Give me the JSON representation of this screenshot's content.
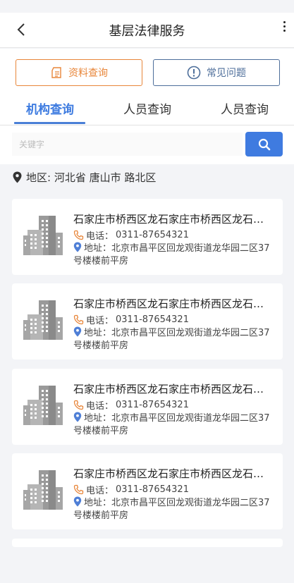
{
  "header": {
    "title": "基层法律服务"
  },
  "buttons": {
    "materials": "资料查询",
    "faq": "常见问题"
  },
  "tabs": [
    {
      "label": "机构查询"
    },
    {
      "label": "人员查询"
    },
    {
      "label": "人员查询"
    }
  ],
  "search": {
    "placeholder": "关键字"
  },
  "region": {
    "text": "地区: 河北省 唐山市 路北区"
  },
  "cards": [
    {
      "name": "石家庄市桥西区龙石家庄市桥西区龙石家庄市桥西区",
      "phone_label": "电话：",
      "phone": "0311-87654321",
      "addr_label": "地址：",
      "addr": "北京市昌平区回龙观街道龙华园二区37号楼楼前平房"
    },
    {
      "name": "石家庄市桥西区龙石家庄市桥西区龙石家庄市桥西区",
      "phone_label": "电话：",
      "phone": "0311-87654321",
      "addr_label": "地址：",
      "addr": "北京市昌平区回龙观街道龙华园二区37号楼楼前平房"
    },
    {
      "name": "石家庄市桥西区龙石家庄市桥西区龙石家庄市桥西区",
      "phone_label": "电话：",
      "phone": "0311-87654321",
      "addr_label": "地址：",
      "addr": "北京市昌平区回龙观街道龙华园二区37号楼楼前平房"
    },
    {
      "name": "石家庄市桥西区龙石家庄市桥西区龙石家庄市桥西区",
      "phone_label": "电话：",
      "phone": "0311-87654321",
      "addr_label": "地址：",
      "addr": "北京市昌平区回龙观街道龙华园二区37号楼楼前平房"
    }
  ],
  "colors": {
    "accent": "#3f7be0",
    "orange": "#e8863a",
    "navy": "#4d6e9a"
  },
  "icons": {
    "back": "chevron-left-icon",
    "more": "more-vertical-icon",
    "materials": "document-icon",
    "faq": "exclamation-circle-icon",
    "search": "search-icon",
    "location": "location-pin-icon",
    "building": "building-icon",
    "phone": "phone-icon"
  }
}
